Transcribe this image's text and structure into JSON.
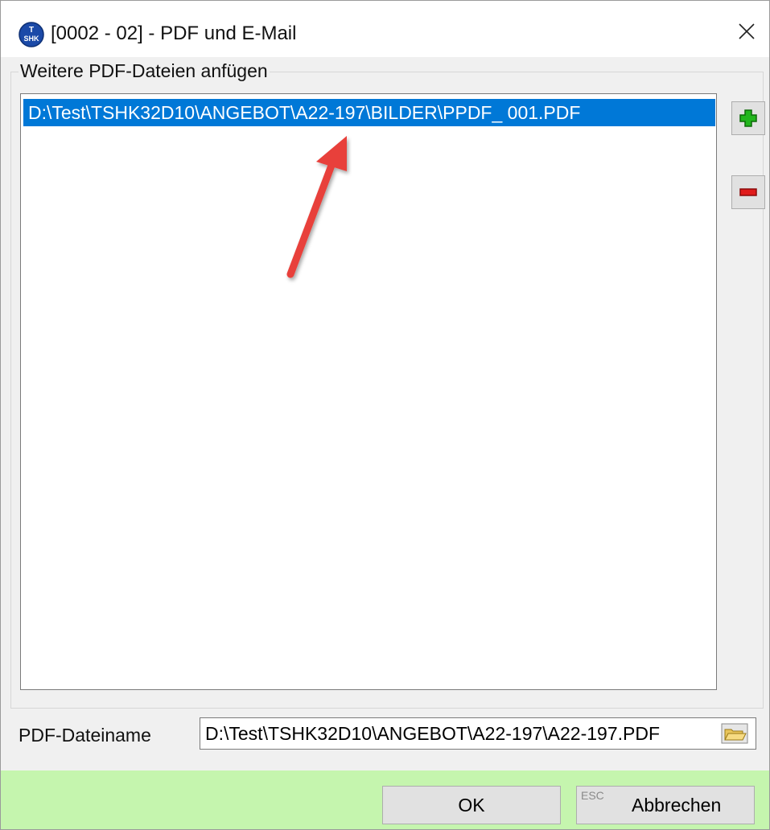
{
  "window": {
    "title": "[0002 - 02] - PDF und E-Mail",
    "app_icon_text": "SHK",
    "close_glyph": "×"
  },
  "attachments": {
    "group_label": "Weitere PDF-Dateien anfügen",
    "items": [
      {
        "path": "D:\\Test\\TSHK32D10\\ANGEBOT\\A22-197\\BILDER\\PPDF_  001.PDF",
        "selected": true
      }
    ],
    "add_icon": "plus-icon",
    "remove_icon": "minus-icon",
    "annotation": "red-arrow"
  },
  "pdf_filename": {
    "label": "PDF-Dateiname",
    "value": "D:\\Test\\TSHK32D10\\ANGEBOT\\A22-197\\A22-197.PDF",
    "browse_icon": "folder-open-icon"
  },
  "footer": {
    "ok_label": "OK",
    "cancel_hint": "ESC",
    "cancel_label": "Abbrechen"
  },
  "colors": {
    "selection": "#0078d7",
    "footer_bg": "#c5f5ae",
    "add_green": "#22b61d",
    "remove_red": "#e01b1b",
    "arrow_red": "#e8413b"
  }
}
